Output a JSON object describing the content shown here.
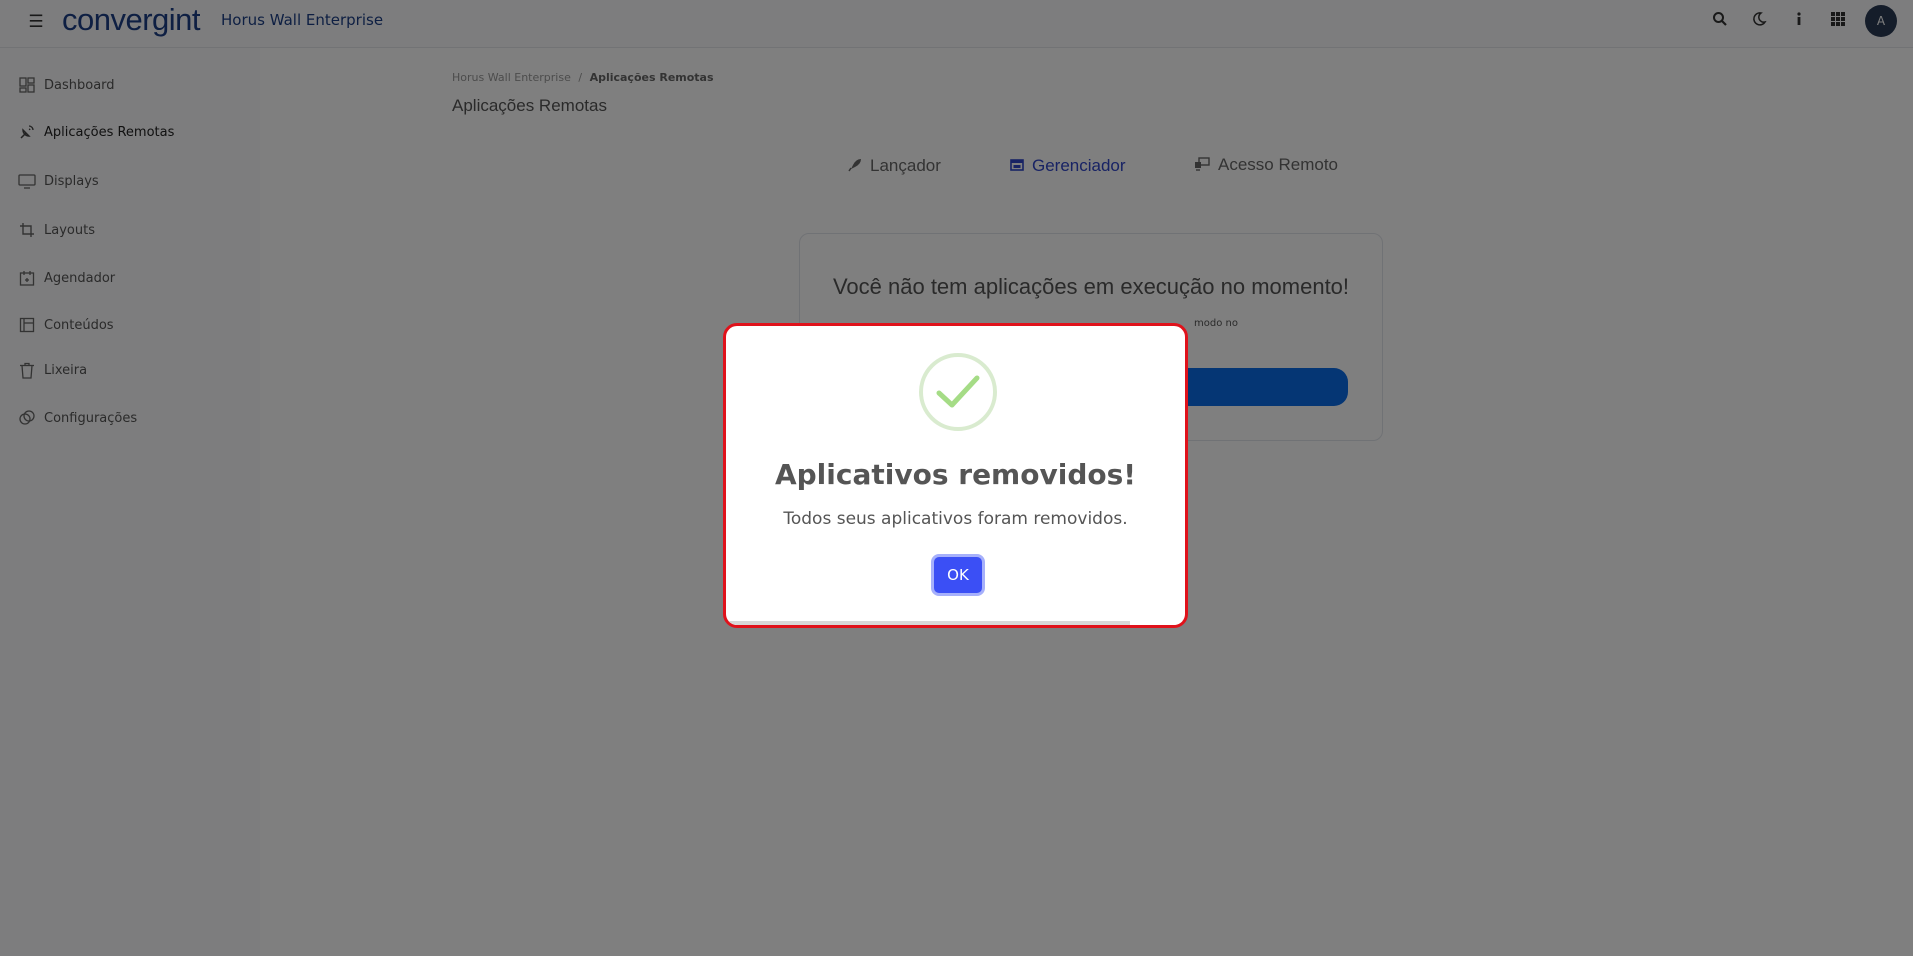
{
  "header": {
    "logo": "convergint",
    "app_title": "Horus Wall Enterprise",
    "icons": [
      "search-icon",
      "moon-icon",
      "info-icon",
      "apps-grid-icon"
    ],
    "avatar_initial": "A"
  },
  "sidebar": {
    "items": [
      {
        "label": "Dashboard",
        "icon": "dashboard-icon"
      },
      {
        "label": "Aplicações Remotas",
        "icon": "satellite-icon",
        "active": true
      },
      {
        "label": "Displays",
        "icon": "monitor-icon"
      },
      {
        "label": "Layouts",
        "icon": "crop-icon"
      },
      {
        "label": "Agendador",
        "icon": "calendar-icon"
      },
      {
        "label": "Conteúdos",
        "icon": "content-icon"
      },
      {
        "label": "Lixeira",
        "icon": "trash-icon"
      },
      {
        "label": "Configurações",
        "icon": "settings-icon"
      }
    ]
  },
  "breadcrumb": {
    "root": "Horus Wall Enterprise",
    "separator": "/",
    "current": "Aplicações Remotas"
  },
  "page_title": "Aplicações Remotas",
  "tabs": [
    {
      "label": "Lançador",
      "icon": "rocket-icon"
    },
    {
      "label": "Gerenciador",
      "icon": "window-icon",
      "active": true
    },
    {
      "label": "Acesso Remoto",
      "icon": "remote-desktop-icon"
    }
  ],
  "empty_state": {
    "title": "Você não tem aplicações em execução no momento!",
    "subtitle_visible": "modo no"
  },
  "modal": {
    "title": "Aplicativos removidos!",
    "message": "Todos seus aplicativos foram removidos.",
    "ok_label": "OK",
    "icon": "check-icon",
    "timer_progress_percent": 88
  },
  "colors": {
    "brand": "#1c3f86",
    "active_tab": "#3046c9",
    "ok_button": "#3b4ff5",
    "highlight_border": "#e0121b",
    "success_check": "#a5dc86"
  }
}
